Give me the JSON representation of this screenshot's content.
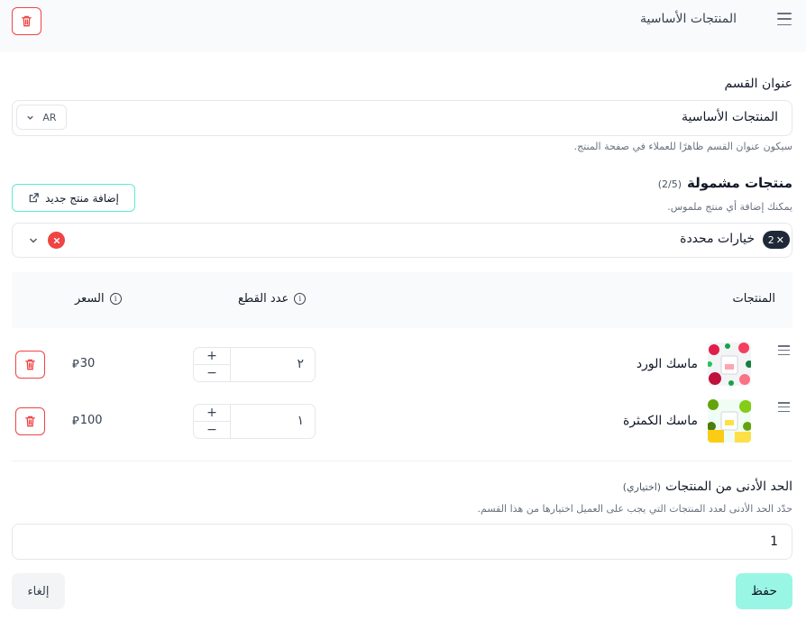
{
  "header": {
    "title": "المنتجات الأساسية",
    "menu_icon": "hamburger-icon",
    "delete_icon": "trash-icon"
  },
  "section_title": {
    "label": "عنوان القسم",
    "value": "المنتجات الأساسية",
    "language": "AR",
    "help": "سيكون عنوان القسم ظاهرًا للعملاء في صفحة المنتج."
  },
  "included_products": {
    "label": "منتجات مشمولة",
    "count": "(2/5)",
    "help": "يمكنك إضافة أي منتج ملموس.",
    "add_button": "إضافة منتج جديد",
    "selected_count": "2",
    "selected_label": "خيارات محددة"
  },
  "table": {
    "col_products": "المنتجات",
    "col_quantity": "عدد القطع",
    "col_price": "السعر",
    "rows": [
      {
        "name": "ماسك الورد",
        "quantity": "٢",
        "price": "30",
        "currency": "⃁"
      },
      {
        "name": "ماسك الكمثرة",
        "quantity": "١",
        "price": "100",
        "currency": "⃁"
      }
    ]
  },
  "minimum": {
    "label": "الحد الأدنى من المنتجات",
    "optional": "(اختياري)",
    "help": "حدّد الحد الأدنى لعدد المنتجات التي يجب على العميل اختيارها من هذا القسم.",
    "value": "1"
  },
  "actions": {
    "save": "حفظ",
    "cancel": "إلغاء"
  },
  "colors": {
    "danger": "#ef4444",
    "accent": "#99f6e4",
    "accent_border": "#5eead4"
  }
}
